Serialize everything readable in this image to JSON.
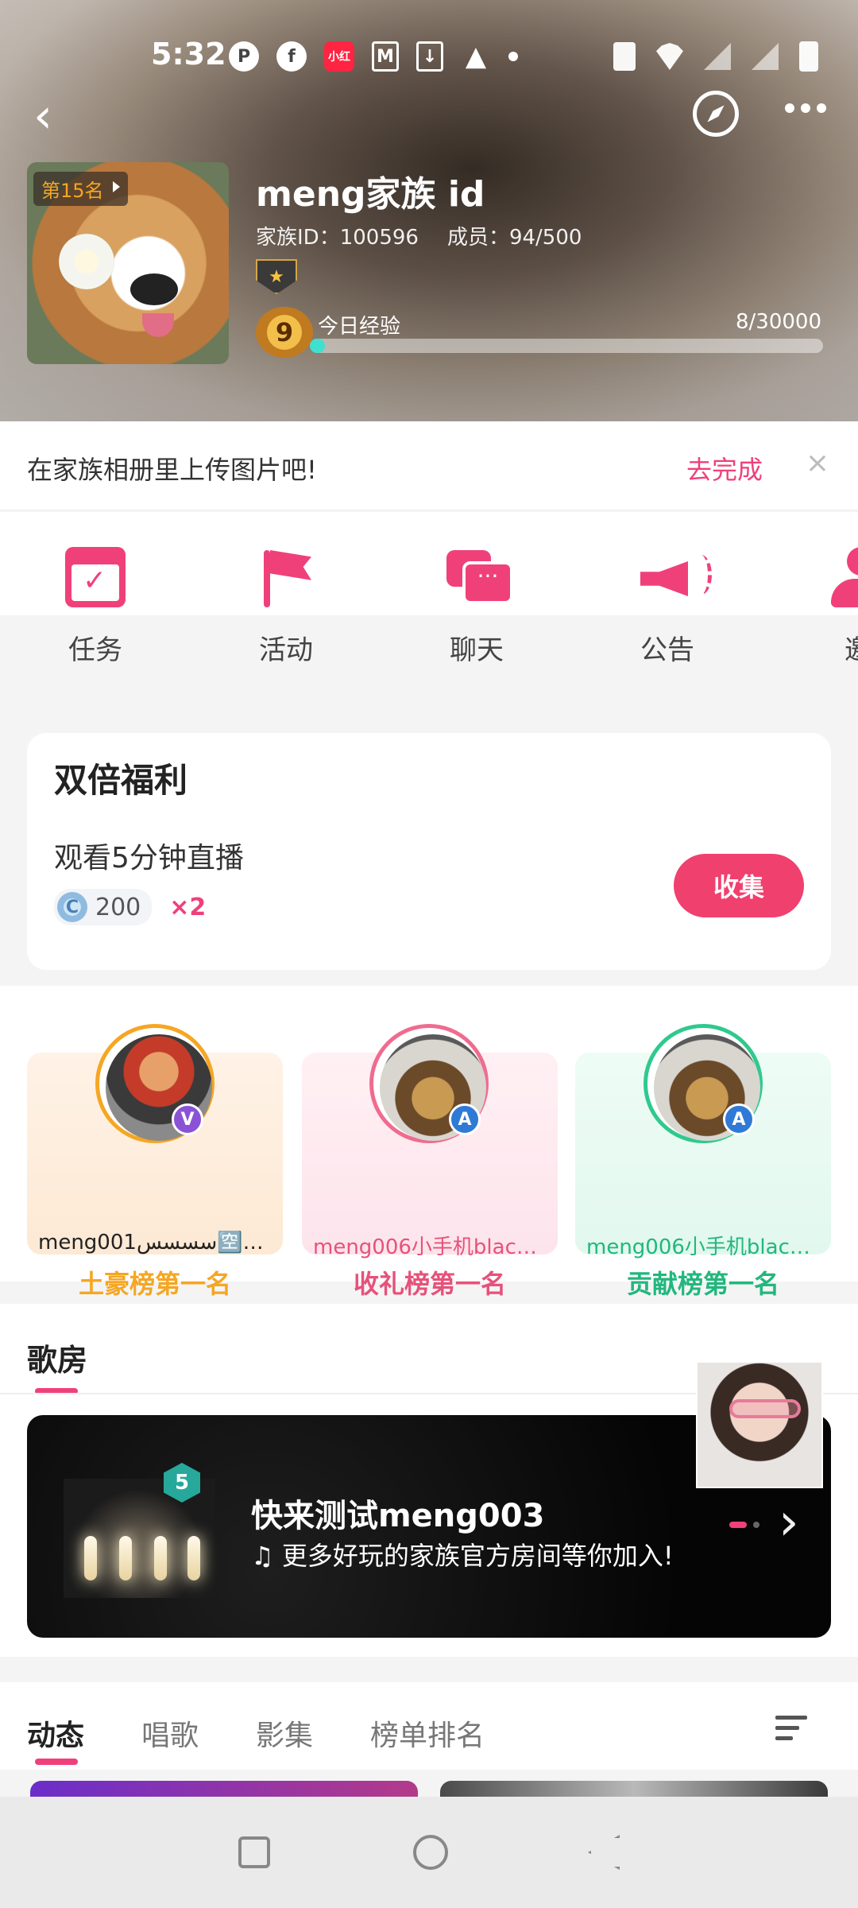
{
  "status_bar": {
    "time": "5:32"
  },
  "family": {
    "rank_badge": "第15名",
    "name": "meng家族 id",
    "id_text": "家族ID：100596",
    "members_text": "成员：94/500",
    "level": "9",
    "exp_label": "今日经验",
    "exp_value": "8/30000",
    "exp_progress": 0.03
  },
  "upload_tip": {
    "text": "在家族相册里上传图片吧!",
    "action": "去完成",
    "close": "×"
  },
  "shortcuts": [
    {
      "label": "任务",
      "icon": "calendar-check-icon"
    },
    {
      "label": "活动",
      "icon": "flag-icon"
    },
    {
      "label": "聊天",
      "icon": "chat-bubbles-icon"
    },
    {
      "label": "公告",
      "icon": "megaphone-icon"
    },
    {
      "label": "邀",
      "icon": "user-icon"
    }
  ],
  "benefit": {
    "title": "双倍福利",
    "task": "观看5分钟直播",
    "coin_amount": "200",
    "multiplier": "×2",
    "button": "收集"
  },
  "leaderboards": [
    {
      "name": "meng001ﺳﺴﺴﺲ🈳❎...",
      "title": "土豪榜第一名",
      "badge": "V",
      "color": "#f5a623"
    },
    {
      "name": "meng006小手机black...",
      "title": "收礼榜第一名",
      "badge": "A",
      "color": "#e6527a"
    },
    {
      "name": "meng006小手机black...",
      "title": "贡献榜第一名",
      "badge": "A",
      "color": "#22b77d"
    }
  ],
  "karaoke": {
    "section_title": "歌房",
    "room_level": "5",
    "room_name": "快来测试meng003",
    "room_desc": "♫ 更多好玩的家族官方房间等你加入!",
    "arrow": "›"
  },
  "tabs": [
    {
      "label": "动态",
      "active": true
    },
    {
      "label": "唱歌",
      "active": false
    },
    {
      "label": "影集",
      "active": false
    },
    {
      "label": "榜单排名",
      "active": false
    }
  ],
  "colors": {
    "accent": "#f0407a",
    "progress": "#3ee0d0"
  }
}
